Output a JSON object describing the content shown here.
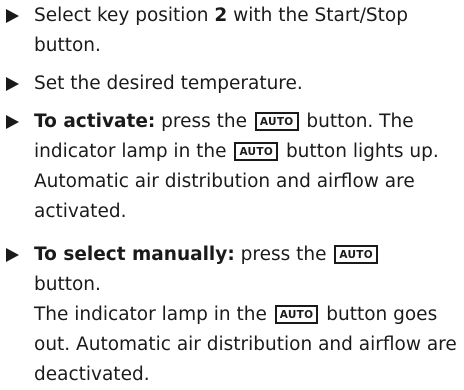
{
  "items": [
    {
      "before": "Select key position ",
      "bold": "2",
      "after": " with the Start/Stop button."
    },
    {
      "text": "Set the desired temperature."
    },
    {
      "lead": "To activate:",
      "a": " press the ",
      "key1": "AUTO",
      "b": " button. The indicator lamp in the ",
      "key2": "AUTO",
      "c": " button lights up. Automatic air distribution and airflow are activated."
    },
    {
      "lead": "To select manually:",
      "a": " press the ",
      "key1": "AUTO",
      "b": " button.",
      "c": "The indicator lamp in the ",
      "key2": "AUTO",
      "d": " button goes out. Automatic air distribution and airflow are deactivated."
    }
  ]
}
